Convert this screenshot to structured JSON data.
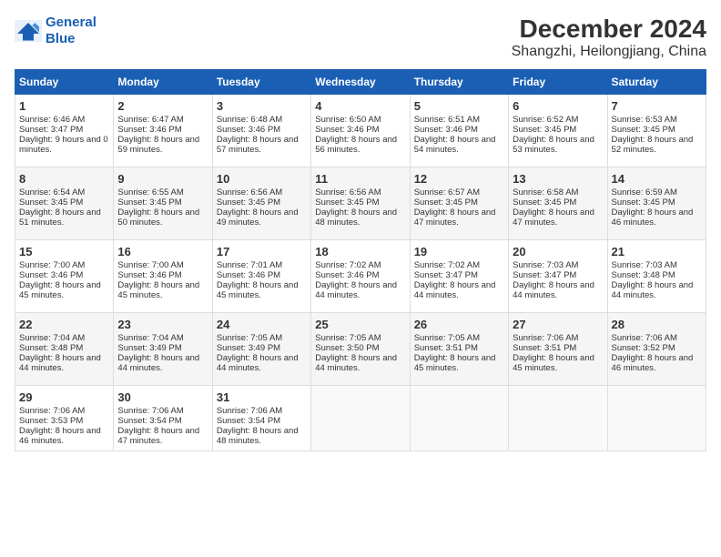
{
  "header": {
    "logo_line1": "General",
    "logo_line2": "Blue",
    "month": "December 2024",
    "location": "Shangzhi, Heilongjiang, China"
  },
  "days_of_week": [
    "Sunday",
    "Monday",
    "Tuesday",
    "Wednesday",
    "Thursday",
    "Friday",
    "Saturday"
  ],
  "weeks": [
    [
      {
        "day": 1,
        "rise": "6:46 AM",
        "set": "3:47 PM",
        "daylight": "9 hours and 0 minutes."
      },
      {
        "day": 2,
        "rise": "6:47 AM",
        "set": "3:46 PM",
        "daylight": "8 hours and 59 minutes."
      },
      {
        "day": 3,
        "rise": "6:48 AM",
        "set": "3:46 PM",
        "daylight": "8 hours and 57 minutes."
      },
      {
        "day": 4,
        "rise": "6:50 AM",
        "set": "3:46 PM",
        "daylight": "8 hours and 56 minutes."
      },
      {
        "day": 5,
        "rise": "6:51 AM",
        "set": "3:46 PM",
        "daylight": "8 hours and 54 minutes."
      },
      {
        "day": 6,
        "rise": "6:52 AM",
        "set": "3:45 PM",
        "daylight": "8 hours and 53 minutes."
      },
      {
        "day": 7,
        "rise": "6:53 AM",
        "set": "3:45 PM",
        "daylight": "8 hours and 52 minutes."
      }
    ],
    [
      {
        "day": 8,
        "rise": "6:54 AM",
        "set": "3:45 PM",
        "daylight": "8 hours and 51 minutes."
      },
      {
        "day": 9,
        "rise": "6:55 AM",
        "set": "3:45 PM",
        "daylight": "8 hours and 50 minutes."
      },
      {
        "day": 10,
        "rise": "6:56 AM",
        "set": "3:45 PM",
        "daylight": "8 hours and 49 minutes."
      },
      {
        "day": 11,
        "rise": "6:56 AM",
        "set": "3:45 PM",
        "daylight": "8 hours and 48 minutes."
      },
      {
        "day": 12,
        "rise": "6:57 AM",
        "set": "3:45 PM",
        "daylight": "8 hours and 47 minutes."
      },
      {
        "day": 13,
        "rise": "6:58 AM",
        "set": "3:45 PM",
        "daylight": "8 hours and 47 minutes."
      },
      {
        "day": 14,
        "rise": "6:59 AM",
        "set": "3:45 PM",
        "daylight": "8 hours and 46 minutes."
      }
    ],
    [
      {
        "day": 15,
        "rise": "7:00 AM",
        "set": "3:46 PM",
        "daylight": "8 hours and 45 minutes."
      },
      {
        "day": 16,
        "rise": "7:00 AM",
        "set": "3:46 PM",
        "daylight": "8 hours and 45 minutes."
      },
      {
        "day": 17,
        "rise": "7:01 AM",
        "set": "3:46 PM",
        "daylight": "8 hours and 45 minutes."
      },
      {
        "day": 18,
        "rise": "7:02 AM",
        "set": "3:46 PM",
        "daylight": "8 hours and 44 minutes."
      },
      {
        "day": 19,
        "rise": "7:02 AM",
        "set": "3:47 PM",
        "daylight": "8 hours and 44 minutes."
      },
      {
        "day": 20,
        "rise": "7:03 AM",
        "set": "3:47 PM",
        "daylight": "8 hours and 44 minutes."
      },
      {
        "day": 21,
        "rise": "7:03 AM",
        "set": "3:48 PM",
        "daylight": "8 hours and 44 minutes."
      }
    ],
    [
      {
        "day": 22,
        "rise": "7:04 AM",
        "set": "3:48 PM",
        "daylight": "8 hours and 44 minutes."
      },
      {
        "day": 23,
        "rise": "7:04 AM",
        "set": "3:49 PM",
        "daylight": "8 hours and 44 minutes."
      },
      {
        "day": 24,
        "rise": "7:05 AM",
        "set": "3:49 PM",
        "daylight": "8 hours and 44 minutes."
      },
      {
        "day": 25,
        "rise": "7:05 AM",
        "set": "3:50 PM",
        "daylight": "8 hours and 44 minutes."
      },
      {
        "day": 26,
        "rise": "7:05 AM",
        "set": "3:51 PM",
        "daylight": "8 hours and 45 minutes."
      },
      {
        "day": 27,
        "rise": "7:06 AM",
        "set": "3:51 PM",
        "daylight": "8 hours and 45 minutes."
      },
      {
        "day": 28,
        "rise": "7:06 AM",
        "set": "3:52 PM",
        "daylight": "8 hours and 46 minutes."
      }
    ],
    [
      {
        "day": 29,
        "rise": "7:06 AM",
        "set": "3:53 PM",
        "daylight": "8 hours and 46 minutes."
      },
      {
        "day": 30,
        "rise": "7:06 AM",
        "set": "3:54 PM",
        "daylight": "8 hours and 47 minutes."
      },
      {
        "day": 31,
        "rise": "7:06 AM",
        "set": "3:54 PM",
        "daylight": "8 hours and 48 minutes."
      },
      null,
      null,
      null,
      null
    ]
  ]
}
